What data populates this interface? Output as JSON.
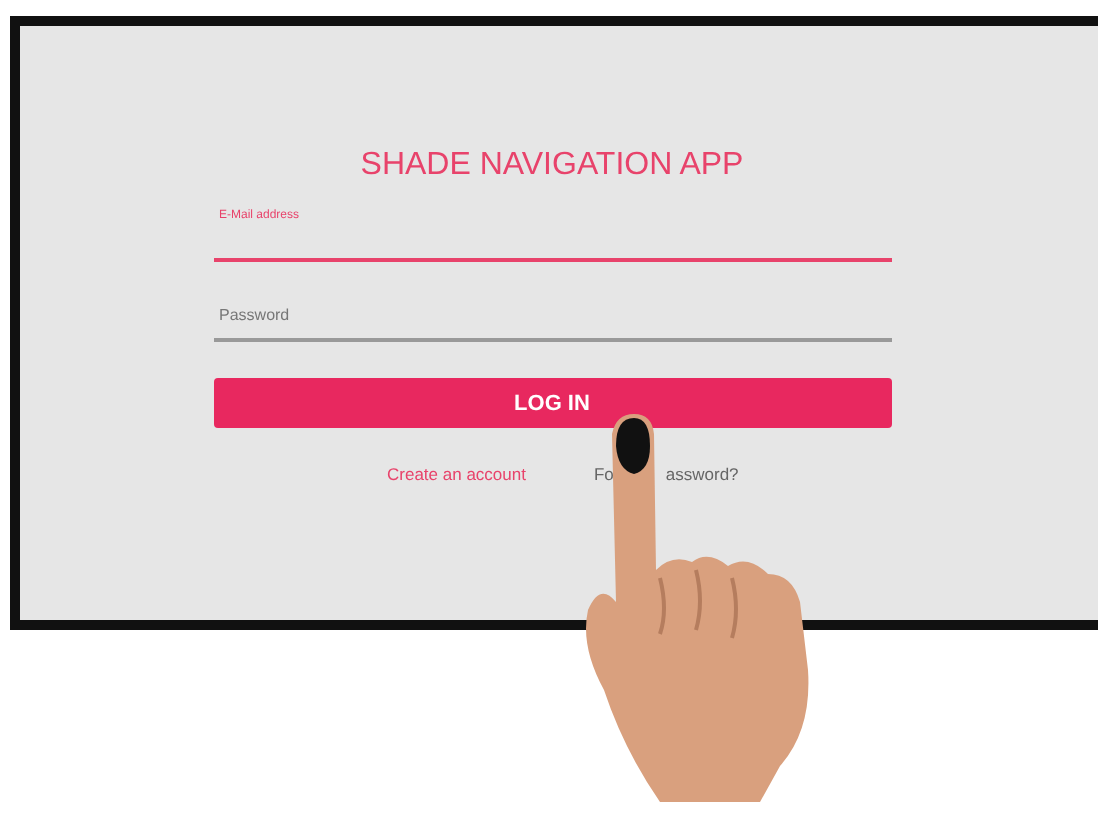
{
  "title": "SHADE NAVIGATION APP",
  "fields": [
    {
      "label": "E-Mail address",
      "focused": true
    },
    {
      "label": "Password",
      "focused": false
    }
  ],
  "login_button": "LOG IN",
  "create_account_link": "Create an account",
  "forgot_link_visible_parts": [
    "Fo",
    "assword?"
  ]
}
